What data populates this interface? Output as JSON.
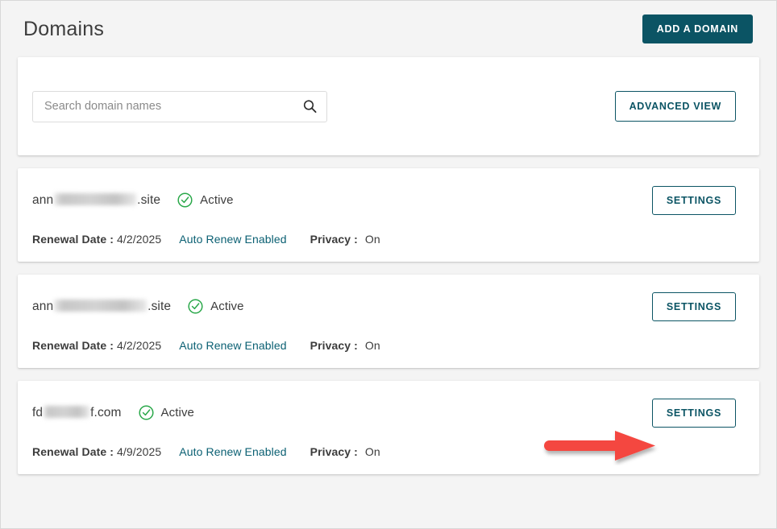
{
  "header": {
    "title": "Domains",
    "add_domain_label": "ADD A DOMAIN"
  },
  "search": {
    "placeholder": "Search domain names",
    "value": "",
    "search_icon": "search-icon",
    "advanced_view_label": "ADVANCED VIEW"
  },
  "labels": {
    "settings": "SETTINGS",
    "renewal_label": "Renewal Date :",
    "privacy_label": "Privacy :",
    "status_icon": "check-circle-icon"
  },
  "colors": {
    "brand_teal": "#0b5464",
    "link_teal": "#0b6073",
    "status_green": "#2aa84a",
    "annotation_red": "#f4463f",
    "page_background": "#f4f4f4",
    "card_background": "#ffffff"
  },
  "domains": [
    {
      "name_prefix": "ann",
      "name_redacted_width": 102,
      "name_suffix": ".site",
      "status": "Active",
      "renewal_date": "4/2/2025",
      "auto_renew": "Auto Renew Enabled",
      "privacy": "On",
      "settings_label": "SETTINGS"
    },
    {
      "name_prefix": "ann",
      "name_redacted_width": 115,
      "name_suffix": ".site",
      "status": "Active",
      "renewal_date": "4/2/2025",
      "auto_renew": "Auto Renew Enabled",
      "privacy": "On",
      "settings_label": "SETTINGS"
    },
    {
      "name_prefix": "fd",
      "name_redacted_width": 57,
      "name_suffix": "f.com",
      "status": "Active",
      "renewal_date": "4/9/2025",
      "auto_renew": "Auto Renew Enabled",
      "privacy": "On",
      "settings_label": "SETTINGS"
    }
  ],
  "annotation": {
    "type": "arrow",
    "direction": "right",
    "points_at": "settings-button-row-3",
    "color": "#f4463f"
  }
}
